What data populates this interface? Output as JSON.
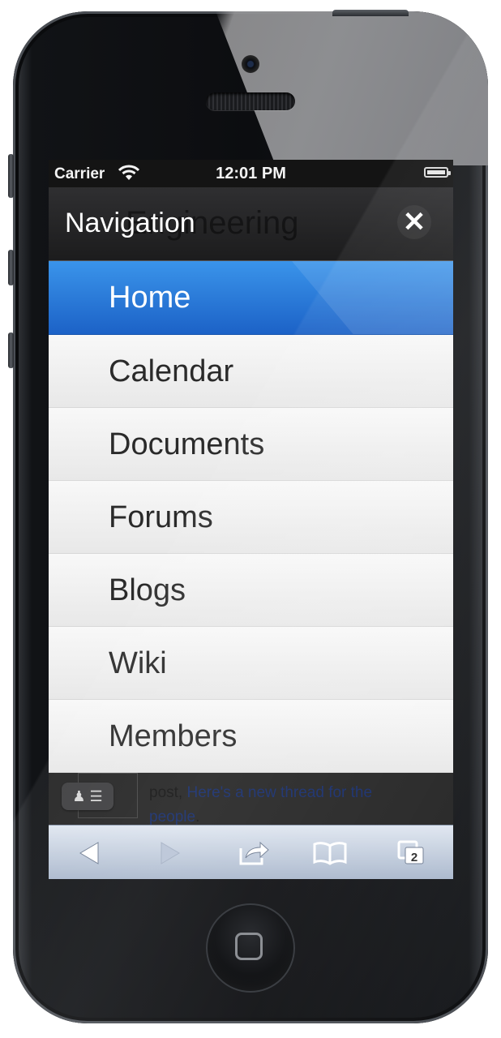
{
  "status_bar": {
    "carrier": "Carrier",
    "time": "12:01 PM"
  },
  "navigation": {
    "title": "Navigation",
    "background_title": "Engineering",
    "close_icon": "close-icon",
    "items": [
      {
        "label": "Home",
        "active": true
      },
      {
        "label": "Calendar",
        "active": false
      },
      {
        "label": "Documents",
        "active": false
      },
      {
        "label": "Forums",
        "active": false
      },
      {
        "label": "Blogs",
        "active": false
      },
      {
        "label": "Wiki",
        "active": false
      },
      {
        "label": "Members",
        "active": false
      }
    ]
  },
  "page_behind": {
    "text_prefix": "post, ",
    "link_text": "Here's a new thread for the",
    "link_text_2": "people",
    "text_suffix": "."
  },
  "toolbar": {
    "tabs_count": "2"
  },
  "colors": {
    "active_blue": "#2a78dc",
    "navbar": "#262627",
    "toolbar": "#c3cedd"
  }
}
